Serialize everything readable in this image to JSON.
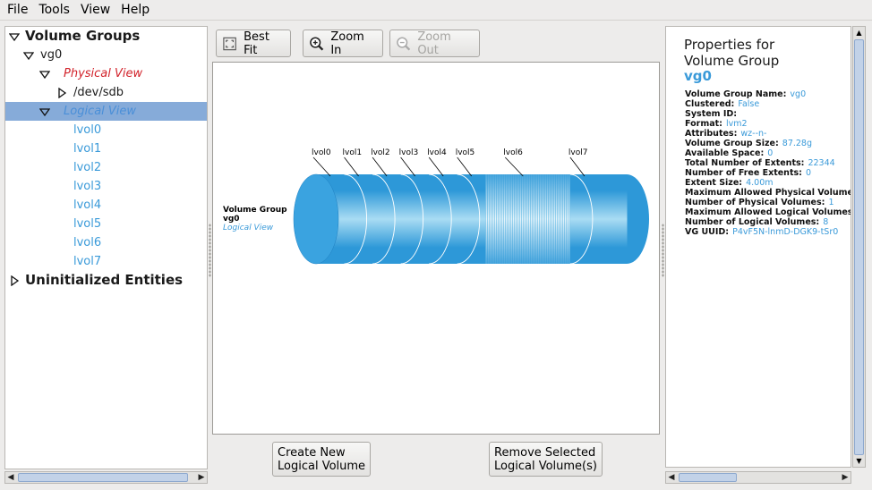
{
  "menu": {
    "file": "File",
    "tools": "Tools",
    "view": "View",
    "help": "Help"
  },
  "tree": {
    "volume_groups": "Volume Groups",
    "vg": "vg0",
    "physical_view": "Physical View",
    "pv_device": "/dev/sdb",
    "logical_view": "Logical View",
    "logical_volumes": [
      "lvol0",
      "lvol1",
      "lvol2",
      "lvol3",
      "lvol4",
      "lvol5",
      "lvol6",
      "lvol7"
    ],
    "uninitialized": "Uninitialized Entities"
  },
  "toolbar": {
    "best_fit": "Best Fit",
    "zoom_in": "Zoom In",
    "zoom_out": "Zoom Out"
  },
  "canvas": {
    "caption_title": "Volume Group",
    "caption_name": "vg0",
    "caption_view": "Logical View",
    "segments": [
      {
        "label": "lvol0",
        "share": 1
      },
      {
        "label": "lvol1",
        "share": 1
      },
      {
        "label": "lvol2",
        "share": 1
      },
      {
        "label": "lvol3",
        "share": 1
      },
      {
        "label": "lvol4",
        "share": 1
      },
      {
        "label": "lvol5",
        "share": 1
      },
      {
        "label": "",
        "share": 3,
        "free": true
      },
      {
        "label": "lvol7",
        "share": 2
      }
    ],
    "unused_label": "lvol6",
    "colors": {
      "lv_main": "#2d98d8",
      "lv_light": "#a9dcf3",
      "end_cap": "#3aa3e0",
      "free_hatch": "#9ad3ee"
    }
  },
  "actions": {
    "create_line1": "Create New",
    "create_line2": "Logical Volume",
    "remove_line1": "Remove Selected",
    "remove_line2": "Logical Volume(s)"
  },
  "properties": {
    "title_line1": "Properties for",
    "title_line2": "Volume Group",
    "name": "vg0",
    "rows": [
      {
        "key": "Volume Group Name:",
        "value": "vg0"
      },
      {
        "key": "Clustered:",
        "value": "False"
      },
      {
        "key": "System ID:",
        "value": ""
      },
      {
        "key": "Format:",
        "value": "lvm2"
      },
      {
        "key": "Attributes:",
        "value": "wz--n-"
      },
      {
        "key": "Volume Group Size:",
        "value": "87.28g"
      },
      {
        "key": "Available Space:",
        "value": "0"
      },
      {
        "key": "Total Number of Extents:",
        "value": "22344"
      },
      {
        "key": "Number of Free Extents:",
        "value": "0"
      },
      {
        "key": "Extent Size:",
        "value": "4.00m"
      },
      {
        "key": "Maximum Allowed Physical Volumes:",
        "value": ""
      },
      {
        "key": "Number of Physical Volumes:",
        "value": "1"
      },
      {
        "key": "Maximum Allowed Logical Volumes:",
        "value": ""
      },
      {
        "key": "Number of Logical Volumes:",
        "value": "8"
      },
      {
        "key": "VG UUID:",
        "value": "P4vF5N-lnmD-DGK9-tSr0"
      }
    ]
  }
}
